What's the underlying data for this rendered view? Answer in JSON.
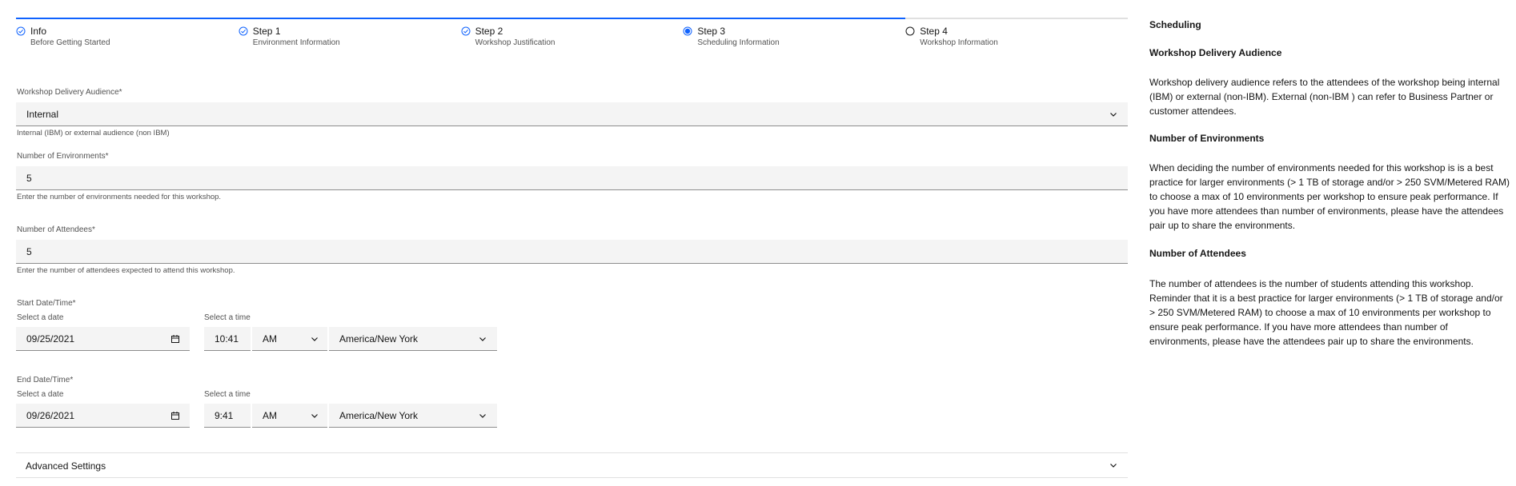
{
  "progress": {
    "steps": [
      {
        "title": "Info",
        "subtitle": "Before Getting Started",
        "state": "complete"
      },
      {
        "title": "Step 1",
        "subtitle": "Environment Information",
        "state": "complete"
      },
      {
        "title": "Step 2",
        "subtitle": "Workshop Justification",
        "state": "complete"
      },
      {
        "title": "Step 3",
        "subtitle": "Scheduling Information",
        "state": "current"
      },
      {
        "title": "Step 4",
        "subtitle": "Workshop Information",
        "state": "incomplete"
      }
    ]
  },
  "form": {
    "audience": {
      "label": "Workshop Delivery Audience*",
      "value": "Internal",
      "helper": "Internal (IBM) or external audience (non IBM)"
    },
    "environments": {
      "label": "Number of Environments*",
      "value": "5",
      "helper": "Enter the number of environments needed for this workshop."
    },
    "attendees": {
      "label": "Number of Attendees*",
      "value": "5",
      "helper": "Enter the number of attendees expected to attend this workshop."
    },
    "start": {
      "label": "Start Date/Time*",
      "date_label": "Select a date",
      "time_label": "Select a time",
      "date": "09/25/2021",
      "time": "10:41",
      "ampm": "AM",
      "timezone": "America/New York"
    },
    "end": {
      "label": "End Date/Time*",
      "date_label": "Select a date",
      "time_label": "Select a time",
      "date": "09/26/2021",
      "time": "9:41",
      "ampm": "AM",
      "timezone": "America/New York"
    },
    "advanced": {
      "label": "Advanced Settings"
    }
  },
  "sidebar": {
    "title": "Scheduling",
    "sections": [
      {
        "heading": "Workshop Delivery Audience",
        "text": "Workshop delivery audience refers to the attendees of the workshop being internal (IBM) or external (non-IBM). External (non-IBM ) can refer to Business Partner or customer attendees."
      },
      {
        "heading": "Number of Environments",
        "text": "When deciding the number of environments needed for this workshop is is a best practice for larger environments (> 1 TB of storage and/or > 250 SVM/Metered RAM) to choose a max of 10 environments per workshop to ensure peak performance. If you have more attendees than number of environments, please have the attendees pair up to share the environments."
      },
      {
        "heading": "Number of Attendees",
        "text": "The number of attendees is the number of students attending this workshop. Reminder that it is a best practice for larger environments (> 1 TB of storage and/or > 250 SVM/Metered RAM) to choose a max of 10 environments per workshop to ensure peak performance. If you have more attendees than number of environments, please have the attendees pair up to share the environments."
      }
    ]
  },
  "colors": {
    "accent": "#0f62fe",
    "field_bg": "#f4f4f4"
  }
}
